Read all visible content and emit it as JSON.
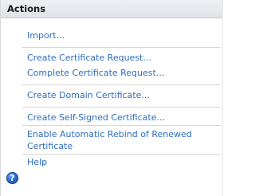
{
  "panel": {
    "title": "Actions",
    "items": [
      {
        "label": "Import..."
      },
      {
        "label": "Create Certificate Request..."
      },
      {
        "label": "Complete Certificate Request..."
      },
      {
        "label": "Create Domain Certificate..."
      },
      {
        "label": "Create Self-Signed Certificate..."
      },
      {
        "label": "Enable Automatic Rebind of Renewed Certificate"
      }
    ],
    "help": {
      "label": "Help",
      "icon": "help-icon",
      "icon_glyph": "?"
    }
  }
}
